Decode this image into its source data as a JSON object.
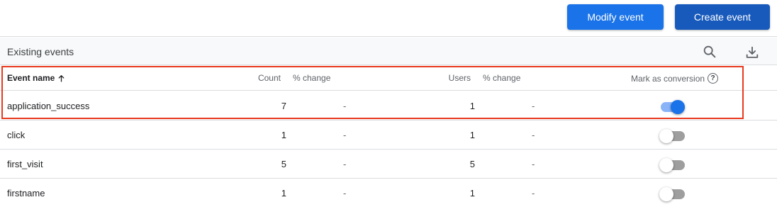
{
  "toolbar": {
    "modify_label": "Modify event",
    "create_label": "Create event"
  },
  "section": {
    "title": "Existing events",
    "search_icon": "search-icon",
    "download_icon": "download-icon"
  },
  "columns": {
    "event_name": "Event name",
    "count": "Count",
    "count_change": "% change",
    "users": "Users",
    "users_change": "% change",
    "mark_conversion": "Mark as conversion",
    "help_glyph": "?"
  },
  "sort": {
    "column": "Event name",
    "direction": "ascending"
  },
  "events": [
    {
      "name": "application_success",
      "count": "7",
      "count_change": "-",
      "users": "1",
      "users_change": "-",
      "conversion": true
    },
    {
      "name": "click",
      "count": "1",
      "count_change": "-",
      "users": "1",
      "users_change": "-",
      "conversion": false
    },
    {
      "name": "first_visit",
      "count": "5",
      "count_change": "-",
      "users": "5",
      "users_change": "-",
      "conversion": false
    },
    {
      "name": "firstname",
      "count": "1",
      "count_change": "-",
      "users": "1",
      "users_change": "-",
      "conversion": false
    }
  ],
  "highlighted_row": "application_success",
  "colors": {
    "primary": "#1a73e8",
    "primary_dark": "#185abc",
    "highlight": "#e8391e",
    "toggle_off": "#9e9e9e",
    "toggle_on_track": "#8ab4f8"
  }
}
